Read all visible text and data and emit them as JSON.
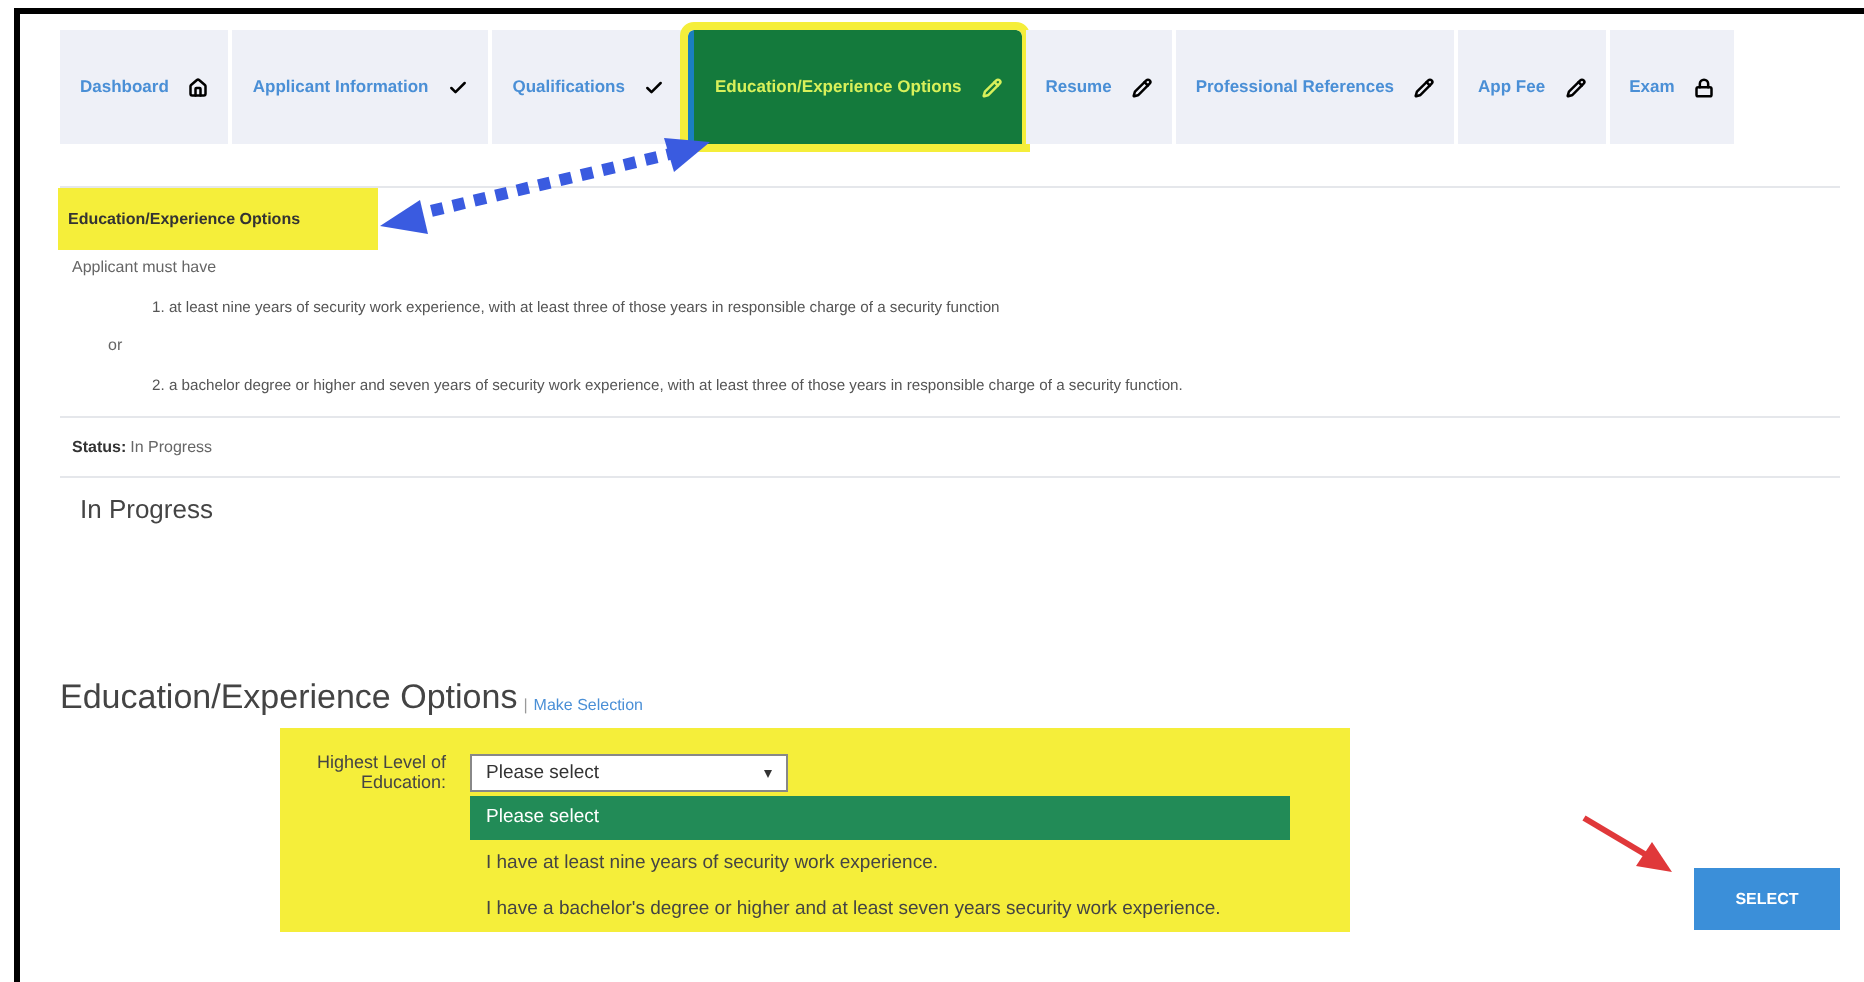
{
  "tabs": [
    {
      "label": "Dashboard",
      "kind": "home",
      "selected": false
    },
    {
      "label": "Applicant Information",
      "kind": "check",
      "selected": false
    },
    {
      "label": "Qualifications",
      "kind": "check",
      "selected": false
    },
    {
      "label": "Education/Experience Options",
      "kind": "pencil",
      "selected": true
    },
    {
      "label": "Resume",
      "kind": "pencil",
      "selected": false
    },
    {
      "label": "Professional References",
      "kind": "pencil",
      "selected": false
    },
    {
      "label": "App Fee",
      "kind": "pencil",
      "selected": false
    },
    {
      "label": "Exam",
      "kind": "lock",
      "selected": false
    }
  ],
  "section": {
    "title": "Education/Experience Options",
    "intro": "Applicant must have",
    "separator": "or",
    "requirements": [
      "1. at least nine years of security work experience, with at least three of those years in responsible charge of a security function",
      "2. a bachelor degree or higher and seven years of security work experience, with at least three of those years in responsible charge of a security function."
    ]
  },
  "status": {
    "label": "Status:",
    "value": "In Progress",
    "heading": "In Progress"
  },
  "selection": {
    "title": "Education/Experience Options",
    "divider": "|",
    "link": "Make Selection",
    "field_label": "Highest Level of Education:",
    "value": "Please select",
    "options": [
      {
        "label": "Please select",
        "selected": true
      },
      {
        "label": "I have at least nine years of security work experience.",
        "selected": false
      },
      {
        "label": "I have a bachelor's degree or higher and at least seven years security work experience.",
        "selected": false
      }
    ],
    "button": "SELECT"
  }
}
